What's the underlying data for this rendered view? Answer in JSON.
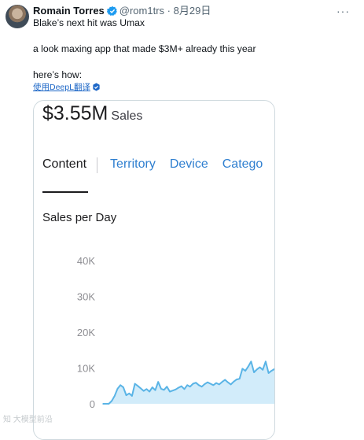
{
  "tweet": {
    "author_name": "Romain Torres",
    "handle": "@rom1trs",
    "separator": "·",
    "date": "8月29日",
    "more_label": "···",
    "lines": [
      "Blake’s next hit was Umax",
      "a look maxing app that made $3M+ already this year",
      "here’s how:"
    ],
    "translate_label": "使用DeepL翻译"
  },
  "media": {
    "sales_value": "$3.55M",
    "sales_label": "Sales",
    "tabs": [
      "Content",
      "Territory",
      "Device",
      "Catego"
    ],
    "active_tab": "Content",
    "chart_title": "Sales per Day"
  },
  "chart_data": {
    "type": "area",
    "title": "Sales per Day",
    "yticks": [
      "40K",
      "30K",
      "20K",
      "10K",
      "0"
    ],
    "ylim": [
      0,
      40000
    ],
    "color": "#5ab4e6",
    "fill": "#d2ecfa",
    "x": [
      1,
      2,
      3,
      4,
      5,
      6,
      7,
      8,
      9,
      10,
      11,
      12,
      13,
      14,
      15,
      16,
      17,
      18,
      19,
      20,
      21,
      22,
      23,
      24,
      25,
      26,
      27,
      28,
      29,
      30,
      31,
      32,
      33,
      34,
      35,
      36,
      37,
      38,
      39,
      40,
      41,
      42,
      43,
      44,
      45,
      46,
      47,
      48,
      49,
      50,
      51,
      52,
      53,
      54,
      55,
      56,
      57,
      58,
      59,
      60
    ],
    "values": [
      0,
      0,
      0,
      800,
      2200,
      4200,
      5200,
      4600,
      2400,
      2900,
      2200,
      5600,
      5000,
      4300,
      3600,
      4100,
      3400,
      4600,
      3800,
      6100,
      4200,
      3900,
      4800,
      3400,
      3700,
      4000,
      4500,
      4900,
      4100,
      5200,
      4800,
      5600,
      5900,
      5200,
      4800,
      5500,
      6000,
      5600,
      5200,
      5800,
      5400,
      6100,
      6700,
      6000,
      5400,
      6200,
      6800,
      7000,
      9800,
      9200,
      10400,
      11800,
      8800,
      9600,
      10200,
      9500,
      11800,
      8600,
      9200,
      9700
    ]
  },
  "watermark": "知 大模型前沿",
  "colors": {
    "link": "#1d9bf0",
    "verified": "#1d9bf0",
    "tab_link": "#2f7fd0"
  }
}
